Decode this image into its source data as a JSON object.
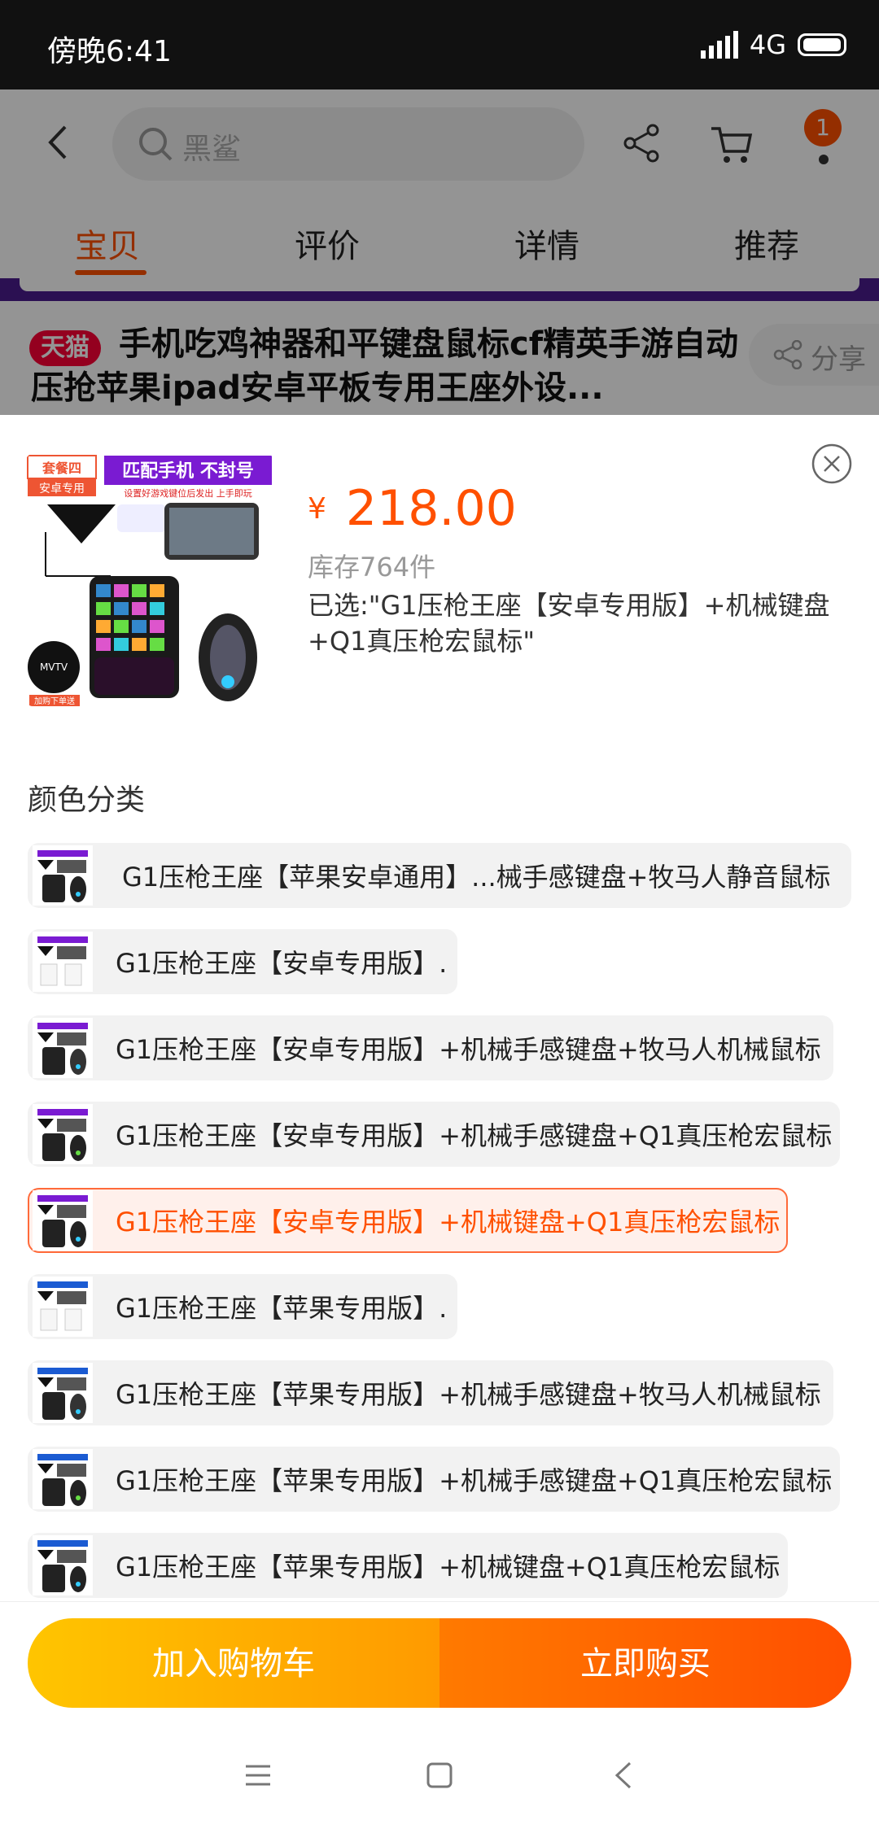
{
  "status_bar": {
    "time": "傍晚6:41",
    "network": "4G"
  },
  "top_nav": {
    "search_placeholder": "黑鲨",
    "cart_badge": "1"
  },
  "tabs": [
    {
      "label": "宝贝",
      "active": true
    },
    {
      "label": "评价",
      "active": false
    },
    {
      "label": "详情",
      "active": false
    },
    {
      "label": "推荐",
      "active": false
    }
  ],
  "product": {
    "platform_tag": "天猫",
    "title": "手机吃鸡神器和平键盘鼠标cf精英手游自动压抢苹果ipad安卓平板专用王座外设...",
    "share_label": "分享"
  },
  "sku_sheet": {
    "currency": "¥",
    "price": "218.00",
    "stock": "库存764件",
    "selected_text": "已选:\"G1压枪王座【安卓专用版】+机械键盘+Q1真压枪宏鼠标\"",
    "thumb": {
      "package_tag": "套餐四",
      "package_sub": "安卓专用",
      "banner": "匹配手机 不封号",
      "banner_sub": "设置好游戏键位后发出 上手即玩",
      "brand": "MVTV",
      "gift_note": "加购下单送"
    },
    "section_label": "颜色分类",
    "options": [
      {
        "label": "G1压枪王座【苹果安卓通用】...械手感键盘+牧马人静音鼠标",
        "selected": false
      },
      {
        "label": "G1压枪王座【安卓专用版】.",
        "selected": false
      },
      {
        "label": "G1压枪王座【安卓专用版】+机械手感键盘+牧马人机械鼠标",
        "selected": false
      },
      {
        "label": "G1压枪王座【安卓专用版】+机械手感键盘+Q1真压枪宏鼠标",
        "selected": false
      },
      {
        "label": "G1压枪王座【安卓专用版】+机械键盘+Q1真压枪宏鼠标",
        "selected": true
      },
      {
        "label": "G1压枪王座【苹果专用版】.",
        "selected": false
      },
      {
        "label": "G1压枪王座【苹果专用版】+机械手感键盘+牧马人机械鼠标",
        "selected": false
      },
      {
        "label": "G1压枪王座【苹果专用版】+机械手感键盘+Q1真压枪宏鼠标",
        "selected": false
      },
      {
        "label": "G1压枪王座【苹果专用版】+机械键盘+Q1真压枪宏鼠标",
        "selected": false
      }
    ]
  },
  "actions": {
    "add_to_cart": "加入购物车",
    "buy_now": "立即购买"
  },
  "colors": {
    "accent": "#ff5000",
    "tmall": "#ff0036",
    "cart_btn": "#ffb300",
    "buy_btn": "#ff5a00"
  }
}
